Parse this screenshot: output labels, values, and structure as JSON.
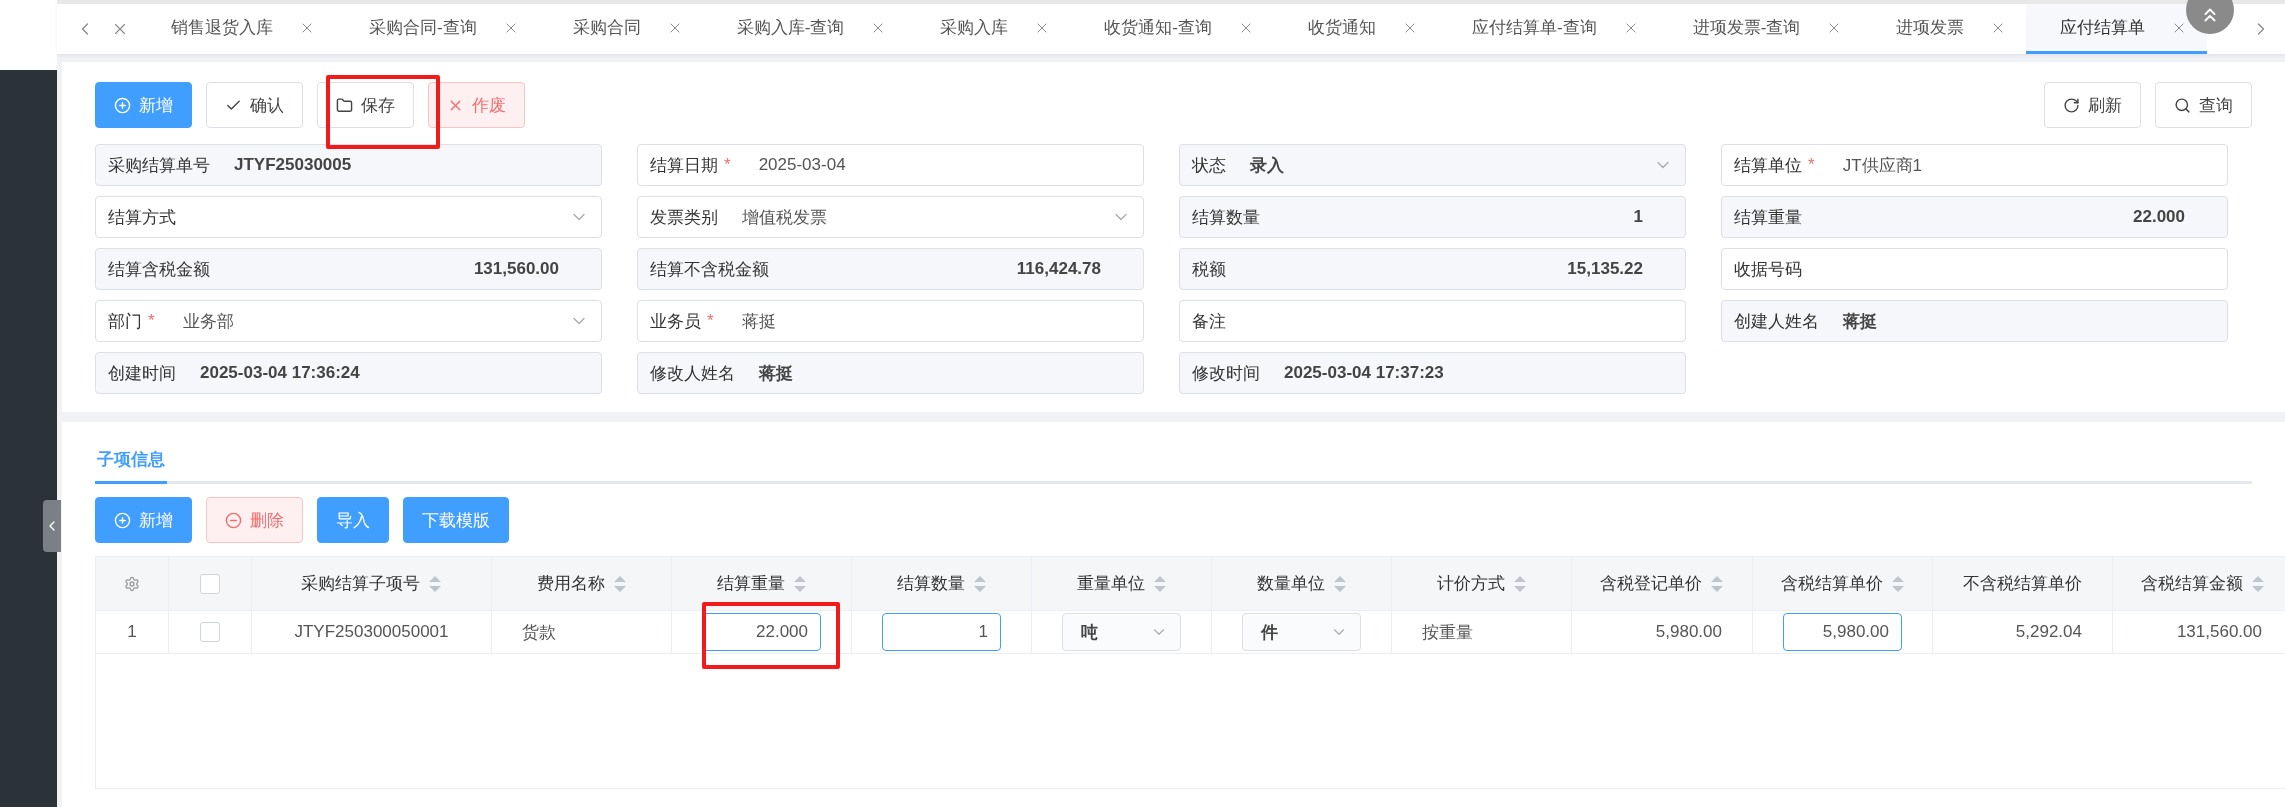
{
  "required_mark": "*",
  "tabs": [
    {
      "label": "销售退货入库",
      "selected": false
    },
    {
      "label": "采购合同-查询",
      "selected": false
    },
    {
      "label": "采购合同",
      "selected": false
    },
    {
      "label": "采购入库-查询",
      "selected": false
    },
    {
      "label": "采购入库",
      "selected": false
    },
    {
      "label": "收货通知-查询",
      "selected": false
    },
    {
      "label": "收货通知",
      "selected": false
    },
    {
      "label": "应付结算单-查询",
      "selected": false
    },
    {
      "label": "进项发票-查询",
      "selected": false
    },
    {
      "label": "进项发票",
      "selected": false
    },
    {
      "label": "应付结算单",
      "selected": true
    }
  ],
  "toolbar": {
    "left": [
      {
        "label": "新增",
        "kind": "add"
      },
      {
        "label": "确认",
        "kind": "confirm"
      },
      {
        "label": "保存",
        "kind": "save"
      },
      {
        "label": "作废",
        "kind": "void"
      }
    ],
    "right": [
      {
        "label": "刷新",
        "kind": "refresh"
      },
      {
        "label": "查询",
        "kind": "search"
      }
    ]
  },
  "form": [
    {
      "label": "采购结算单号",
      "kind": "display",
      "value": "JTYF25030005",
      "required": false
    },
    {
      "label": "结算日期",
      "kind": "input",
      "value": "2025-03-04",
      "required": true
    },
    {
      "label": "状态",
      "kind": "select",
      "value": "录入",
      "required": false,
      "disabled": true
    },
    {
      "label": "结算单位",
      "kind": "input",
      "value": "JT供应商1",
      "required": true
    },
    {
      "label": "结算方式",
      "kind": "select",
      "required": false
    },
    {
      "label": "发票类别",
      "kind": "select",
      "value": "增值税发票",
      "required": false
    },
    {
      "label": "结算数量",
      "kind": "amount",
      "value": "1",
      "required": false
    },
    {
      "label": "结算重量",
      "kind": "amount",
      "value": "22.000",
      "required": false
    },
    {
      "label": "结算含税金额",
      "kind": "amount",
      "value": "131,560.00",
      "required": false
    },
    {
      "label": "结算不含税金额",
      "kind": "amount",
      "value": "116,424.78",
      "required": false
    },
    {
      "label": "税额",
      "kind": "amount",
      "value": "15,135.22",
      "required": false
    },
    {
      "label": "收据号码",
      "kind": "input",
      "required": false
    },
    {
      "label": "部门",
      "kind": "select",
      "value": "业务部",
      "required": true
    },
    {
      "label": "业务员",
      "kind": "input",
      "value": "蒋挺",
      "required": true
    },
    {
      "label": "备注",
      "kind": "input",
      "required": false
    },
    {
      "label": "创建人姓名",
      "kind": "display",
      "value": "蒋挺",
      "required": false
    },
    {
      "label": "创建时间",
      "kind": "display",
      "value": "2025-03-04 17:36:24",
      "required": false
    },
    {
      "label": "修改人姓名",
      "kind": "display",
      "value": "蒋挺",
      "required": false
    },
    {
      "label": "修改时间",
      "kind": "display",
      "value": "2025-03-04 17:37:23",
      "required": false
    }
  ],
  "detail": {
    "tab": {
      "label": "子项信息",
      "selected": true
    },
    "buttons": [
      {
        "label": "新增",
        "kind": "add"
      },
      {
        "label": "删除",
        "kind": "delete"
      },
      {
        "label": "导入",
        "kind": "plain"
      },
      {
        "label": "下载模版",
        "kind": "plain"
      }
    ],
    "table": {
      "header_checked": false,
      "columns": [
        {
          "label": "采购结算子项号",
          "sortable": true
        },
        {
          "label": "费用名称",
          "sortable": true
        },
        {
          "label": "结算重量",
          "sortable": true
        },
        {
          "label": "结算数量",
          "sortable": true
        },
        {
          "label": "重量单位",
          "sortable": true
        },
        {
          "label": "数量单位",
          "sortable": true
        },
        {
          "label": "计价方式",
          "sortable": true
        },
        {
          "label": "含税登记单价",
          "sortable": true
        },
        {
          "label": "含税结算单价",
          "sortable": true
        },
        {
          "label": "不含税结算单价",
          "sortable": false
        },
        {
          "label": "含税结算金额",
          "sortable": true
        }
      ],
      "rows": [
        {
          "index": "1",
          "checked": false,
          "cells": [
            {
              "kind": "center",
              "value": "JTYF250300050001"
            },
            {
              "kind": "text",
              "value": "货款"
            },
            {
              "kind": "input",
              "value": "22.000"
            },
            {
              "kind": "input",
              "value": "1"
            },
            {
              "kind": "select",
              "value": "吨"
            },
            {
              "kind": "select",
              "value": "件"
            },
            {
              "kind": "text",
              "value": "按重量"
            },
            {
              "kind": "number",
              "value": "5,980.00"
            },
            {
              "kind": "input",
              "value": "5,980.00"
            },
            {
              "kind": "number",
              "value": "5,292.04"
            },
            {
              "kind": "number",
              "value": "131,560.00"
            }
          ]
        }
      ]
    }
  }
}
